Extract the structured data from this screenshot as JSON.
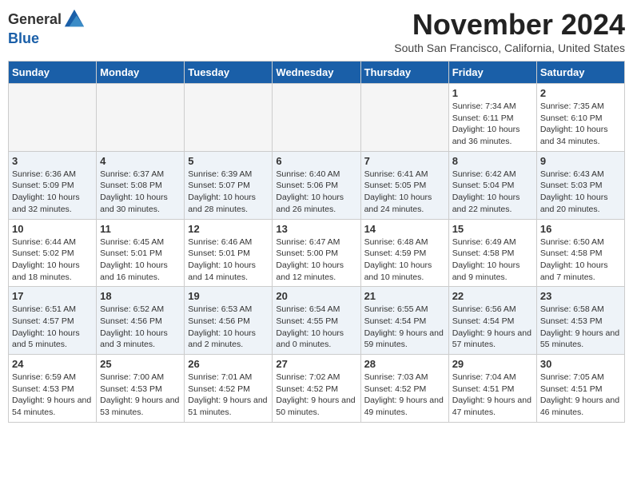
{
  "logo": {
    "general": "General",
    "blue": "Blue"
  },
  "title": "November 2024",
  "location": "South San Francisco, California, United States",
  "days_of_week": [
    "Sunday",
    "Monday",
    "Tuesday",
    "Wednesday",
    "Thursday",
    "Friday",
    "Saturday"
  ],
  "weeks": [
    [
      {
        "day": "",
        "info": ""
      },
      {
        "day": "",
        "info": ""
      },
      {
        "day": "",
        "info": ""
      },
      {
        "day": "",
        "info": ""
      },
      {
        "day": "",
        "info": ""
      },
      {
        "day": "1",
        "info": "Sunrise: 7:34 AM\nSunset: 6:11 PM\nDaylight: 10 hours and 36 minutes."
      },
      {
        "day": "2",
        "info": "Sunrise: 7:35 AM\nSunset: 6:10 PM\nDaylight: 10 hours and 34 minutes."
      }
    ],
    [
      {
        "day": "3",
        "info": "Sunrise: 6:36 AM\nSunset: 5:09 PM\nDaylight: 10 hours and 32 minutes."
      },
      {
        "day": "4",
        "info": "Sunrise: 6:37 AM\nSunset: 5:08 PM\nDaylight: 10 hours and 30 minutes."
      },
      {
        "day": "5",
        "info": "Sunrise: 6:39 AM\nSunset: 5:07 PM\nDaylight: 10 hours and 28 minutes."
      },
      {
        "day": "6",
        "info": "Sunrise: 6:40 AM\nSunset: 5:06 PM\nDaylight: 10 hours and 26 minutes."
      },
      {
        "day": "7",
        "info": "Sunrise: 6:41 AM\nSunset: 5:05 PM\nDaylight: 10 hours and 24 minutes."
      },
      {
        "day": "8",
        "info": "Sunrise: 6:42 AM\nSunset: 5:04 PM\nDaylight: 10 hours and 22 minutes."
      },
      {
        "day": "9",
        "info": "Sunrise: 6:43 AM\nSunset: 5:03 PM\nDaylight: 10 hours and 20 minutes."
      }
    ],
    [
      {
        "day": "10",
        "info": "Sunrise: 6:44 AM\nSunset: 5:02 PM\nDaylight: 10 hours and 18 minutes."
      },
      {
        "day": "11",
        "info": "Sunrise: 6:45 AM\nSunset: 5:01 PM\nDaylight: 10 hours and 16 minutes."
      },
      {
        "day": "12",
        "info": "Sunrise: 6:46 AM\nSunset: 5:01 PM\nDaylight: 10 hours and 14 minutes."
      },
      {
        "day": "13",
        "info": "Sunrise: 6:47 AM\nSunset: 5:00 PM\nDaylight: 10 hours and 12 minutes."
      },
      {
        "day": "14",
        "info": "Sunrise: 6:48 AM\nSunset: 4:59 PM\nDaylight: 10 hours and 10 minutes."
      },
      {
        "day": "15",
        "info": "Sunrise: 6:49 AM\nSunset: 4:58 PM\nDaylight: 10 hours and 9 minutes."
      },
      {
        "day": "16",
        "info": "Sunrise: 6:50 AM\nSunset: 4:58 PM\nDaylight: 10 hours and 7 minutes."
      }
    ],
    [
      {
        "day": "17",
        "info": "Sunrise: 6:51 AM\nSunset: 4:57 PM\nDaylight: 10 hours and 5 minutes."
      },
      {
        "day": "18",
        "info": "Sunrise: 6:52 AM\nSunset: 4:56 PM\nDaylight: 10 hours and 3 minutes."
      },
      {
        "day": "19",
        "info": "Sunrise: 6:53 AM\nSunset: 4:56 PM\nDaylight: 10 hours and 2 minutes."
      },
      {
        "day": "20",
        "info": "Sunrise: 6:54 AM\nSunset: 4:55 PM\nDaylight: 10 hours and 0 minutes."
      },
      {
        "day": "21",
        "info": "Sunrise: 6:55 AM\nSunset: 4:54 PM\nDaylight: 9 hours and 59 minutes."
      },
      {
        "day": "22",
        "info": "Sunrise: 6:56 AM\nSunset: 4:54 PM\nDaylight: 9 hours and 57 minutes."
      },
      {
        "day": "23",
        "info": "Sunrise: 6:58 AM\nSunset: 4:53 PM\nDaylight: 9 hours and 55 minutes."
      }
    ],
    [
      {
        "day": "24",
        "info": "Sunrise: 6:59 AM\nSunset: 4:53 PM\nDaylight: 9 hours and 54 minutes."
      },
      {
        "day": "25",
        "info": "Sunrise: 7:00 AM\nSunset: 4:53 PM\nDaylight: 9 hours and 53 minutes."
      },
      {
        "day": "26",
        "info": "Sunrise: 7:01 AM\nSunset: 4:52 PM\nDaylight: 9 hours and 51 minutes."
      },
      {
        "day": "27",
        "info": "Sunrise: 7:02 AM\nSunset: 4:52 PM\nDaylight: 9 hours and 50 minutes."
      },
      {
        "day": "28",
        "info": "Sunrise: 7:03 AM\nSunset: 4:52 PM\nDaylight: 9 hours and 49 minutes."
      },
      {
        "day": "29",
        "info": "Sunrise: 7:04 AM\nSunset: 4:51 PM\nDaylight: 9 hours and 47 minutes."
      },
      {
        "day": "30",
        "info": "Sunrise: 7:05 AM\nSunset: 4:51 PM\nDaylight: 9 hours and 46 minutes."
      }
    ]
  ]
}
